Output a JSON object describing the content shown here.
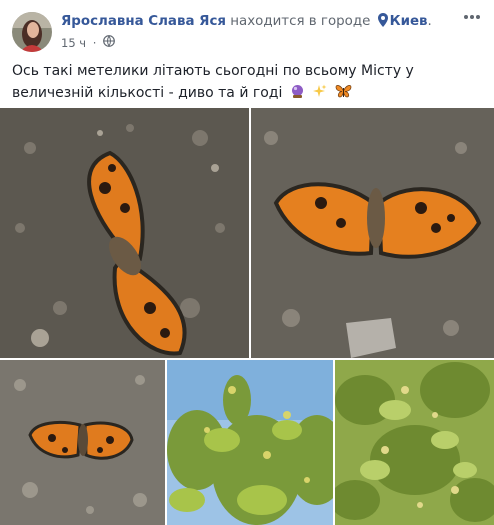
{
  "post": {
    "author": "Ярославна Слава Яся",
    "action": "находится в городе",
    "city": "Киев",
    "separator": ".",
    "time": "15 ч",
    "dot": "·",
    "text": "Ось такі метелики літають сьогодні по всьому Місту у величезній кількості - диво та й годі"
  },
  "icons": {
    "location": "map-pin-icon",
    "privacy": "globe-icon",
    "more": "more-options-icon",
    "emoji": [
      "crystal-ball-emoji",
      "sparkles-emoji",
      "butterfly-emoji"
    ]
  },
  "photos": [
    "butterfly-on-gravel-1",
    "butterfly-on-gravel-2",
    "butterfly-on-gravel-3",
    "tree-blossoms-sky",
    "tree-blossoms-leaves"
  ],
  "colors": {
    "link": "#365899",
    "meta": "#606770",
    "text": "#1d2129"
  }
}
